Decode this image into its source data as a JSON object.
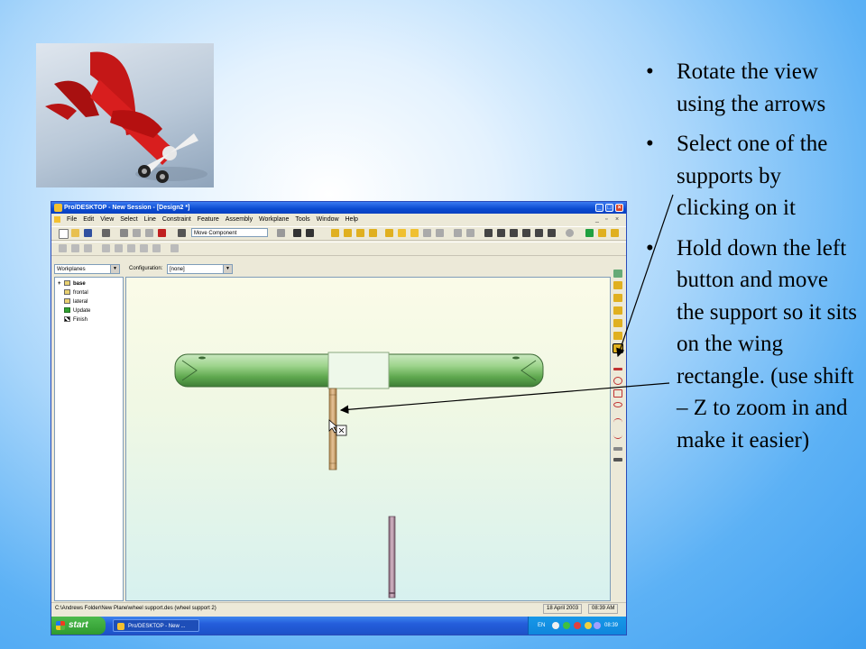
{
  "bullets": [
    "Rotate the view using the arrows",
    "Select one of the supports by clicking on it",
    "Hold down the left button and move the support so it sits on the wing rectangle. (use shift – Z to zoom in and make it easier)"
  ],
  "window": {
    "title": "Pro/DESKTOP - New Session - [Design2 *]",
    "menu": [
      "File",
      "Edit",
      "View",
      "Select",
      "Line",
      "Constraint",
      "Feature",
      "Assembly",
      "Workplane",
      "Tools",
      "Window",
      "Help"
    ],
    "mode_combo": "Move Component",
    "workplanes_combo": "Workplanes",
    "configuration_label": "Configuration:",
    "configuration_combo": "[none]",
    "tree": [
      "base",
      "frontal",
      "lateral",
      "Update",
      "Finish"
    ],
    "status_path": "C:\\Andrews Folder\\New Plane\\wheel support.des (wheel support 2)",
    "status_date": "18 April 2003",
    "status_time": "08:39 AM"
  },
  "taskbar": {
    "start": "start",
    "task": "Pro/DESKTOP - New ...",
    "lang": "EN",
    "clock": "08:39"
  },
  "colors": {
    "wing": "#7fbf6e",
    "support": "#c9a070",
    "titlebar": "#0a4ad0"
  }
}
